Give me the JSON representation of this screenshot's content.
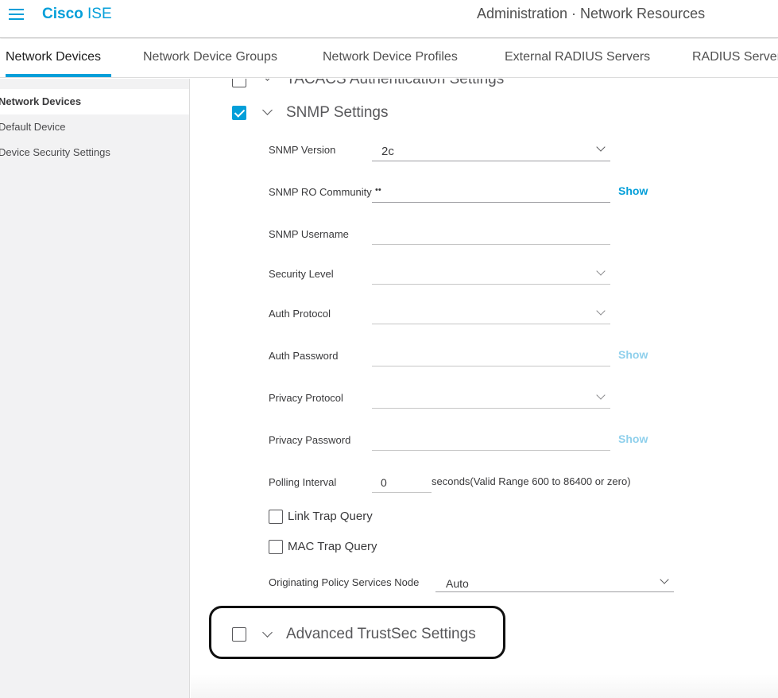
{
  "header": {
    "brand_bold": "Cisco",
    "brand_rest": " ISE",
    "page_title": "Administration · Network Resources",
    "menu_icon": "hamburger-menu-icon"
  },
  "tabs": [
    {
      "label": "Network Devices",
      "active": true
    },
    {
      "label": "Network Device Groups",
      "active": false
    },
    {
      "label": "Network Device Profiles",
      "active": false
    },
    {
      "label": "External RADIUS Servers",
      "active": false
    },
    {
      "label": "RADIUS Servers",
      "active": false
    }
  ],
  "sidebar": {
    "items": [
      {
        "label": "Network Devices",
        "active": true
      },
      {
        "label": "Default Device",
        "active": false
      },
      {
        "label": "Device Security Settings",
        "active": false
      }
    ]
  },
  "sections": {
    "tacacs": {
      "title": "TACACS Authentication Settings",
      "checked": false
    },
    "snmp": {
      "title": "SNMP Settings",
      "checked": true
    },
    "trustsec": {
      "title": "Advanced TrustSec Settings",
      "checked": false
    }
  },
  "snmp": {
    "version": {
      "label": "SNMP Version",
      "value": "2c"
    },
    "ro_community": {
      "label": "SNMP RO Community",
      "value": "••",
      "show_label": "Show"
    },
    "username": {
      "label": "SNMP Username",
      "value": ""
    },
    "security_level": {
      "label": "Security Level",
      "value": ""
    },
    "auth_protocol": {
      "label": "Auth Protocol",
      "value": ""
    },
    "auth_password": {
      "label": "Auth Password",
      "value": "",
      "show_label": "Show"
    },
    "privacy_protocol": {
      "label": "Privacy Protocol",
      "value": ""
    },
    "privacy_password": {
      "label": "Privacy Password",
      "value": "",
      "show_label": "Show"
    },
    "polling_interval": {
      "label": "Polling Interval",
      "value": "0",
      "helper": "seconds(Valid Range 600 to 86400 or zero)"
    },
    "link_trap_query": {
      "label": "Link Trap Query",
      "checked": false
    },
    "mac_trap_query": {
      "label": "MAC Trap Query",
      "checked": false
    },
    "originating_psn": {
      "label": "Originating Policy Services Node",
      "value": "Auto"
    }
  },
  "colors": {
    "accent": "#049fd9",
    "text": "#39393b",
    "sidebar_bg": "#f2f2f3"
  }
}
